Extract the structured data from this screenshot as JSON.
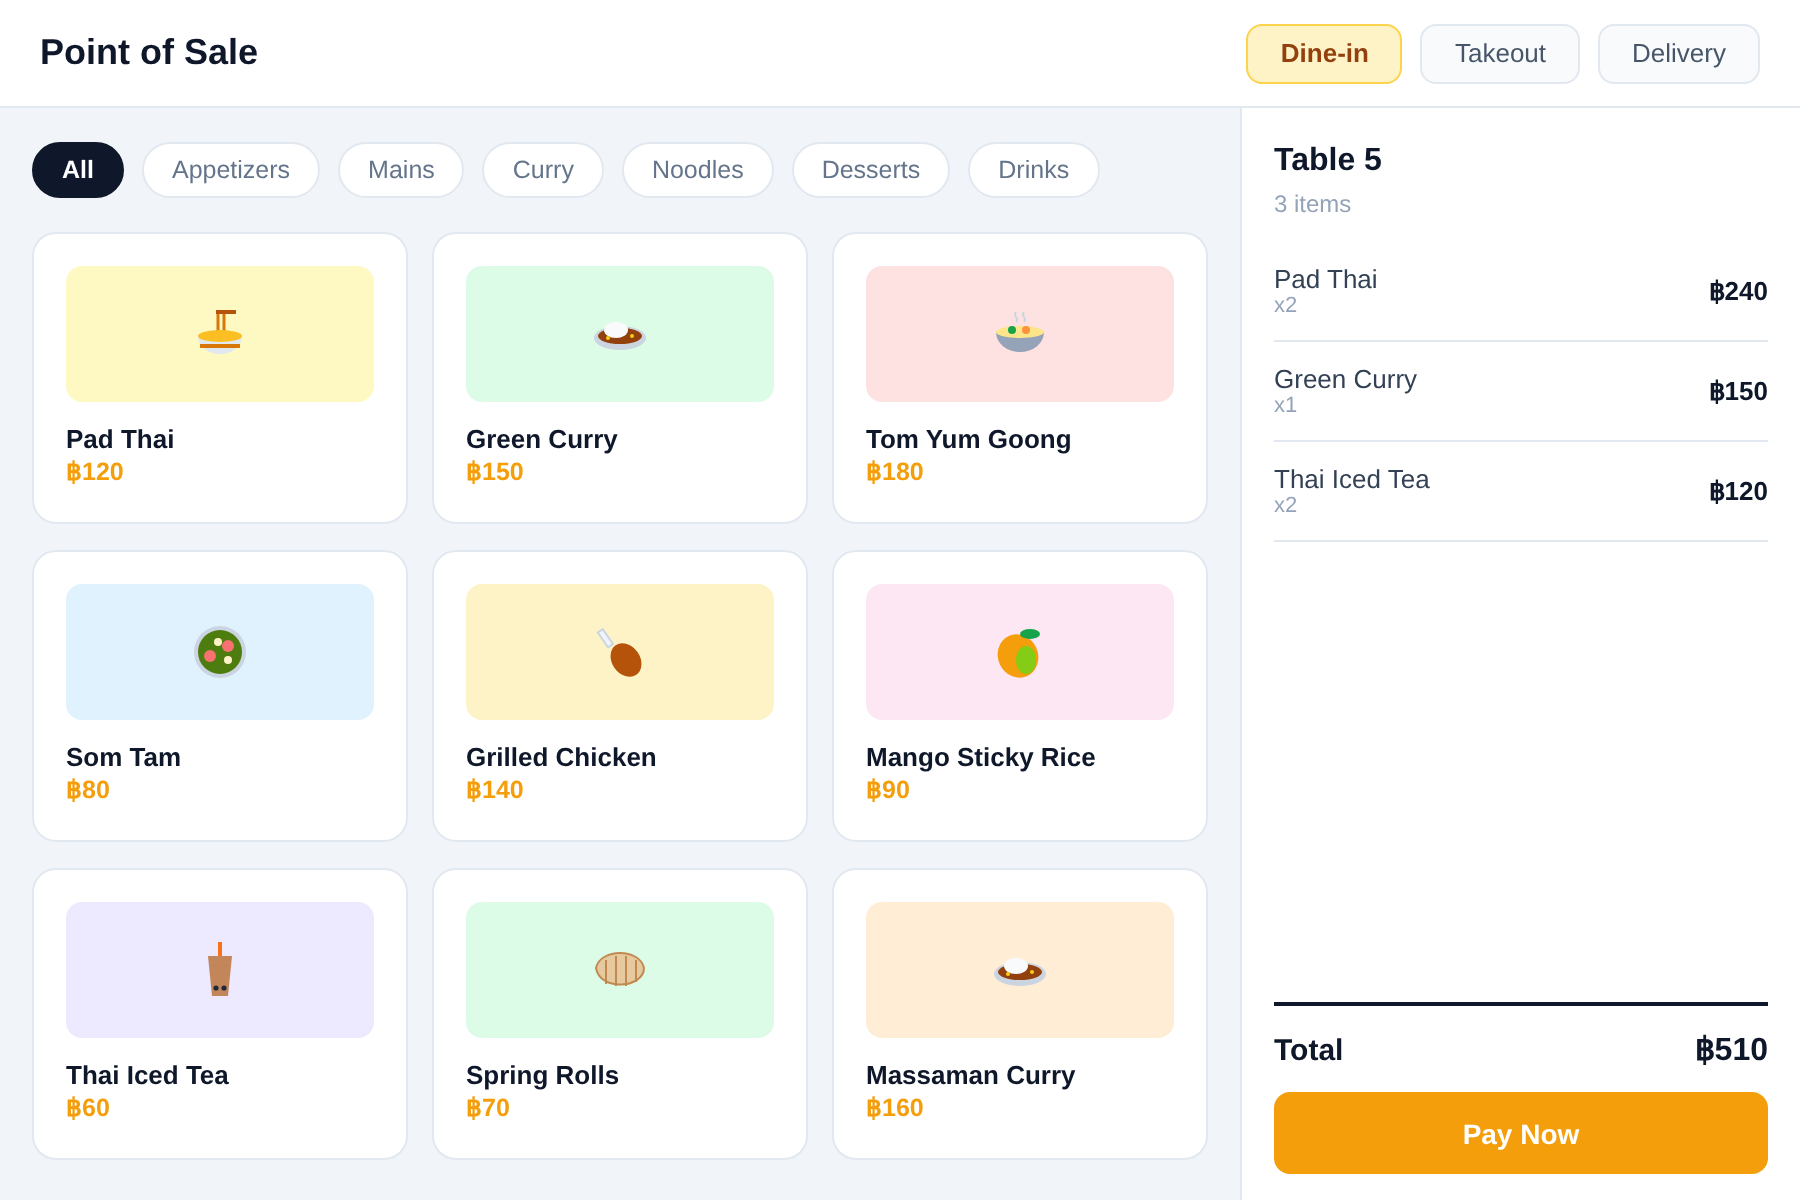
{
  "header": {
    "title": "Point of Sale",
    "order_types": [
      {
        "label": "Dine-in",
        "selected": true
      },
      {
        "label": "Takeout",
        "selected": false
      },
      {
        "label": "Delivery",
        "selected": false
      }
    ]
  },
  "categories": [
    {
      "label": "All",
      "selected": true
    },
    {
      "label": "Appetizers",
      "selected": false
    },
    {
      "label": "Mains",
      "selected": false
    },
    {
      "label": "Curry",
      "selected": false
    },
    {
      "label": "Noodles",
      "selected": false
    },
    {
      "label": "Desserts",
      "selected": false
    },
    {
      "label": "Drinks",
      "selected": false
    }
  ],
  "menu": [
    {
      "name": "Pad Thai",
      "price": "฿120",
      "kind": "noodles",
      "color": "#fef9c3"
    },
    {
      "name": "Green Curry",
      "price": "฿150",
      "kind": "curry",
      "color": "#dcfce7"
    },
    {
      "name": "Tom Yum Goong",
      "price": "฿180",
      "kind": "soup",
      "color": "#fee2e2"
    },
    {
      "name": "Som Tam",
      "price": "฿80",
      "kind": "salad",
      "color": "#e0f2fe"
    },
    {
      "name": "Grilled Chicken",
      "price": "฿140",
      "kind": "drumstick",
      "color": "#fef3c7"
    },
    {
      "name": "Mango Sticky Rice",
      "price": "฿90",
      "kind": "mango",
      "color": "#fce7f3"
    },
    {
      "name": "Thai Iced Tea",
      "price": "฿60",
      "kind": "tea",
      "color": "#ede9fe"
    },
    {
      "name": "Spring Rolls",
      "price": "฿70",
      "kind": "dumpling",
      "color": "#dcfce7"
    },
    {
      "name": "Massaman Curry",
      "price": "฿160",
      "kind": "curry",
      "color": "#ffedd5"
    }
  ],
  "order": {
    "title": "Table 5",
    "count": "3 items",
    "items": [
      {
        "name": "Pad Thai",
        "qty": "x2",
        "amount": "฿240"
      },
      {
        "name": "Green Curry",
        "qty": "x1",
        "amount": "฿150"
      },
      {
        "name": "Thai Iced Tea",
        "qty": "x2",
        "amount": "฿120"
      }
    ],
    "total_label": "Total",
    "total": "฿510",
    "pay_button": "Pay Now"
  }
}
